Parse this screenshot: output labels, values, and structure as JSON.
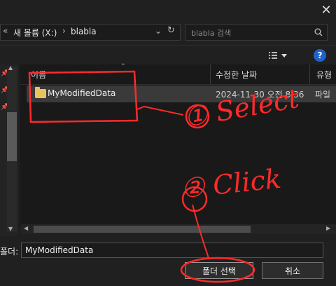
{
  "address": {
    "crumbs": [
      "새 볼륨 (X:)",
      "blabla"
    ],
    "nav_arrow": "«",
    "separator": "›",
    "search_placeholder": "blabla 검색"
  },
  "columns": {
    "name": "이름",
    "date": "수정한 날짜",
    "type": "유형"
  },
  "rows": [
    {
      "name": "MyModifiedData",
      "date": "2024-11-30 오전 8:36",
      "type": "파일"
    }
  ],
  "footer": {
    "folder_label": "폴더:",
    "folder_value": "MyModifiedData",
    "select_button": "폴더 선택",
    "cancel_button": "취소"
  },
  "annotations": {
    "step1": "① Select",
    "step2": "② Click"
  },
  "colors": {
    "annotation": "#ff2a2a",
    "folder": "#e8c55e",
    "help": "#1f62c8"
  }
}
